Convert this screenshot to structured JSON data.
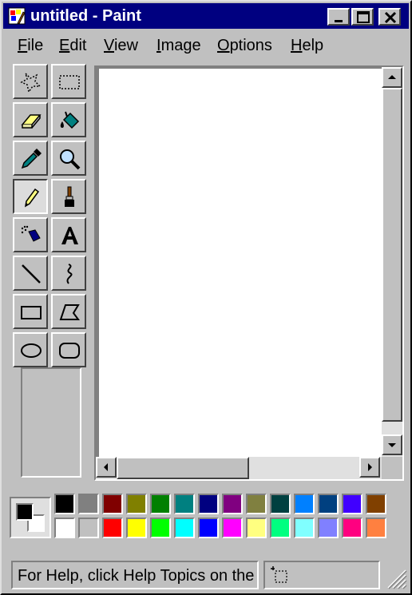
{
  "window": {
    "title": "untitled - Paint"
  },
  "menu": {
    "items": [
      {
        "mn": "F",
        "rest": "ile"
      },
      {
        "mn": "E",
        "rest": "dit"
      },
      {
        "mn": "V",
        "rest": "iew"
      },
      {
        "mn": "I",
        "rest": "mage"
      },
      {
        "mn": "O",
        "rest": "ptions"
      },
      {
        "mn": "H",
        "rest": "elp"
      }
    ]
  },
  "tools": [
    "free-form-select",
    "rectangle-select",
    "eraser",
    "fill-with-color",
    "pick-color",
    "magnifier",
    "pencil",
    "brush",
    "airbrush",
    "text",
    "line",
    "curve",
    "rectangle",
    "polygon",
    "ellipse",
    "rounded-rectangle"
  ],
  "selected_tool": "pencil",
  "colors": {
    "foreground": "#000000",
    "background": "#ffffff",
    "palette_top": [
      "#000000",
      "#808080",
      "#800000",
      "#808000",
      "#008000",
      "#008080",
      "#000080",
      "#800080",
      "#808040",
      "#004040",
      "#0080ff",
      "#004080",
      "#4000ff",
      "#804000"
    ],
    "palette_bottom": [
      "#ffffff",
      "#c0c0c0",
      "#ff0000",
      "#ffff00",
      "#00ff00",
      "#00ffff",
      "#0000ff",
      "#ff00ff",
      "#ffff80",
      "#00ff80",
      "#80ffff",
      "#8080ff",
      "#ff0080",
      "#ff8040"
    ]
  },
  "status": {
    "help_text": "For Help, click Help Topics on the Help Menu."
  }
}
